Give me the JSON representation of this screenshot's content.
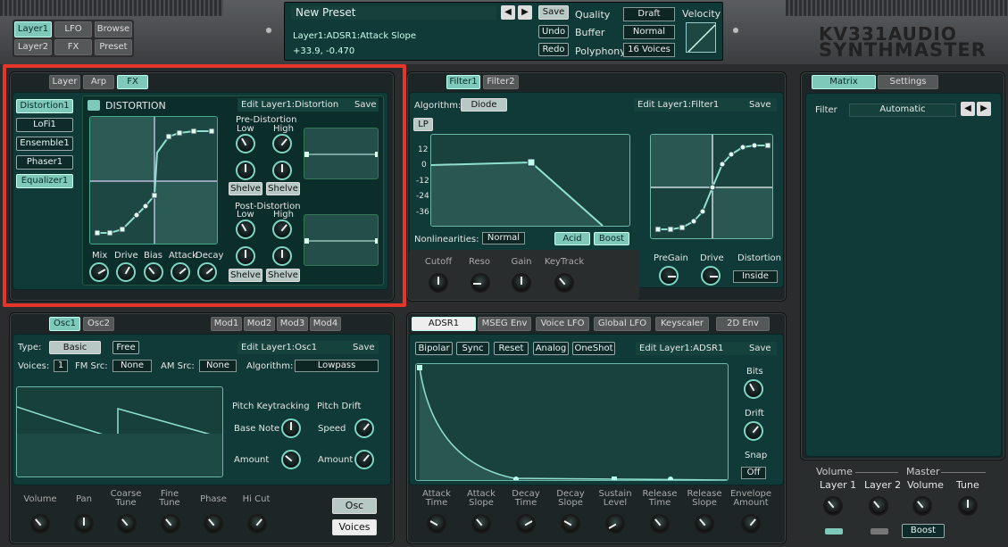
{
  "top": {
    "nav": [
      "Layer1",
      "LFO",
      "Browse",
      "Layer2",
      "FX",
      "Preset"
    ],
    "preset_name": "New Preset",
    "save": "Save",
    "undo": "Undo",
    "redo": "Redo",
    "status_line1": "Layer1:ADSR1:Attack Slope",
    "status_line2": "+33.9, -0.470",
    "quality_label": "Quality",
    "quality_value": "Draft",
    "buffer_label": "Buffer",
    "buffer_value": "Normal",
    "polyphony_label": "Polyphony",
    "polyphony_value": "16 Voices",
    "velocity_label": "Velocity",
    "brand1": "KV331AUDIO",
    "brand2": "SYNTHMASTER"
  },
  "fx": {
    "tabs": [
      "Layer",
      "Arp",
      "FX"
    ],
    "slots": [
      "Distortion1",
      "LoFi1",
      "Ensemble1",
      "Phaser1",
      "Equalizer1"
    ],
    "title": "DISTORTION",
    "edit": "Edit Layer1:Distortion",
    "save": "Save",
    "pre": "Pre-Distortion",
    "post": "Post-Distortion",
    "low": "Low",
    "high": "High",
    "shelve": "Shelve",
    "knobs": [
      "Mix",
      "Drive",
      "Bias",
      "Attack",
      "Decay"
    ]
  },
  "filter": {
    "tabs": [
      "Filter1",
      "Filter2"
    ],
    "algorithm_label": "Algorithm:",
    "algorithm": "Diode",
    "edit": "Edit Layer1:Filter1",
    "save": "Save",
    "mode": "LP",
    "y_ticks": [
      "12",
      "0",
      "-12",
      "-24",
      "-36"
    ],
    "nonlin_label": "Nonlinearities:",
    "nonlin": "Normal",
    "acid": "Acid",
    "boost": "Boost",
    "knobs": [
      "Cutoff",
      "Reso",
      "Gain",
      "KeyTrack"
    ],
    "knobs2": [
      "PreGain",
      "Drive",
      "Distortion"
    ],
    "distortion_mode": "Inside"
  },
  "matrix": {
    "tabs": [
      "Matrix",
      "Settings"
    ],
    "filter_label": "Filter",
    "filter_value": "Automatic"
  },
  "osc": {
    "tabs": [
      "Osc1",
      "Osc2"
    ],
    "mods": [
      "Mod1",
      "Mod2",
      "Mod3",
      "Mod4"
    ],
    "type_label": "Type:",
    "type": "Basic",
    "free": "Free",
    "edit": "Edit Layer1:Osc1",
    "save": "Save",
    "voices_label": "Voices:",
    "voices": "1",
    "fm_label": "FM Src:",
    "fm": "None",
    "am_label": "AM Src:",
    "am": "None",
    "algo_label": "Algorithm:",
    "algo": "Lowpass",
    "pitch_key": "Pitch Keytracking",
    "pitch_drift": "Pitch Drift",
    "base_note": "Base Note",
    "speed": "Speed",
    "amount": "Amount",
    "bottom_knobs": [
      "Volume",
      "Pan",
      "Coarse\nTune",
      "Fine\nTune",
      "Phase",
      "Hi Cut"
    ],
    "osc_btn": "Osc",
    "voices_btn": "Voices"
  },
  "env": {
    "tabs": [
      "ADSR1",
      "MSEG Env",
      "Voice LFO",
      "Global LFO",
      "Keyscaler",
      "2D Env"
    ],
    "options": [
      "Bipolar",
      "Sync",
      "Reset",
      "Analog",
      "OneShot"
    ],
    "edit": "Edit Layer1:ADSR1",
    "save": "Save",
    "bits": "Bits",
    "drift": "Drift",
    "snap": "Snap",
    "snap_value": "Off",
    "bottom_knobs": [
      "Attack\nTime",
      "Attack\nSlope",
      "Decay\nTime",
      "Decay\nSlope",
      "Sustain\nLevel",
      "Release\nTime",
      "Release\nSlope",
      "Envelope\nAmount"
    ]
  },
  "master": {
    "volume_group": "Volume",
    "master_group": "Master",
    "layer1": "Layer 1",
    "layer2": "Layer 2",
    "volume": "Volume",
    "tune": "Tune",
    "boost": "Boost"
  },
  "colors": {
    "accent": "#7fc9ba",
    "highlight": "#e8352a",
    "panel": "#0f3a37"
  }
}
